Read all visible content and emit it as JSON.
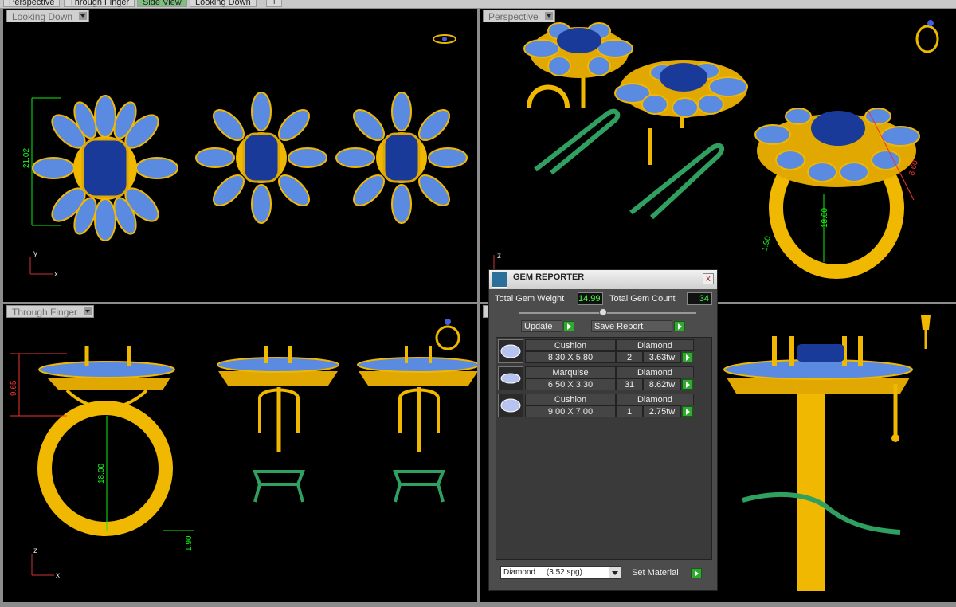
{
  "tabs": [
    "Perspective",
    "Through Finger",
    "Side View",
    "Looking Down",
    "+"
  ],
  "viewports": {
    "top_left": {
      "label": "Looking Down",
      "dim_height": "21.02",
      "axis_y": "y",
      "axis_x": "x"
    },
    "top_right": {
      "label": "Perspective",
      "dim_a": "8.60",
      "dim_b": "18.00",
      "dim_c": "1.90"
    },
    "bottom_left": {
      "label": "Through Finger",
      "dim_a": "9.65",
      "dim_b": "18.00",
      "dim_c": "1.90",
      "axis_z": "z",
      "axis_x": "x"
    },
    "bottom_right": {
      "label": "S"
    },
    "mid_axis_z": "z"
  },
  "gem_reporter": {
    "title": "GEM REPORTER",
    "close": "x",
    "total_weight_label": "Total Gem Weight",
    "total_weight": "14.99",
    "total_count_label": "Total Gem Count",
    "total_count": "34",
    "update_label": "Update",
    "save_label": "Save Report",
    "rows": [
      {
        "shape": "Cushion",
        "material": "Diamond",
        "size": "8.30 X 5.80",
        "count": "2",
        "weight": "3.63tw"
      },
      {
        "shape": "Marquise",
        "material": "Diamond",
        "size": "6.50 X 3.30",
        "count": "31",
        "weight": "8.62tw"
      },
      {
        "shape": "Cushion",
        "material": "Diamond",
        "size": "9.00 X 7.00",
        "count": "1",
        "weight": "2.75tw"
      }
    ],
    "material_select": "Diamond     (3.52 spg)",
    "set_material_label": "Set Material"
  },
  "colors": {
    "gold": "#f0b800",
    "blue_gem": "#5080d0",
    "dark_gem": "#1a3a9a",
    "green_cad": "#30a060"
  }
}
